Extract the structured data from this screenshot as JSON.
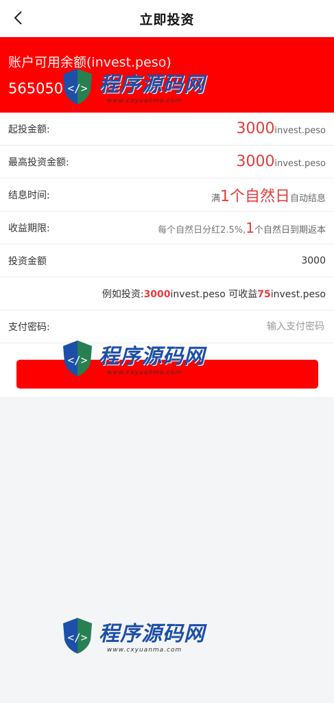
{
  "header": {
    "title": "立即投资",
    "back_icon": "chevron-left-icon"
  },
  "balance": {
    "label": "账户可用余额(invest.peso)",
    "amount": "565050"
  },
  "rows": {
    "min": {
      "label": "起投金额:",
      "value": "3000",
      "unit": "invest.peso"
    },
    "max": {
      "label": "最高投资金额:",
      "value": "3000",
      "unit": "invest.peso"
    },
    "settle": {
      "label": "结息时间:",
      "prefix": "满",
      "value": "1个自然日",
      "suffix": "自动结息"
    },
    "term": {
      "label": "收益期限:",
      "prefix": "每个自然日分红2.5%,",
      "value": "1",
      "suffix": "个自然日到期返本"
    },
    "amount": {
      "label": "投资金额",
      "value": "3000"
    },
    "example": {
      "t1": "例如投资:",
      "v1": "3000",
      "t2": "invest.peso 可收益",
      "v2": "75",
      "t3": "invest.peso"
    },
    "password": {
      "label": "支付密码:",
      "placeholder": "输入支付密码",
      "value": ""
    }
  },
  "submit": {
    "label": ""
  },
  "watermark": {
    "brand": "程序源码网",
    "url": "www.cxyuanma.com"
  },
  "colors": {
    "accent": "#ff0000",
    "highlight": "#e33b3b",
    "brand": "#1d4fa8"
  }
}
